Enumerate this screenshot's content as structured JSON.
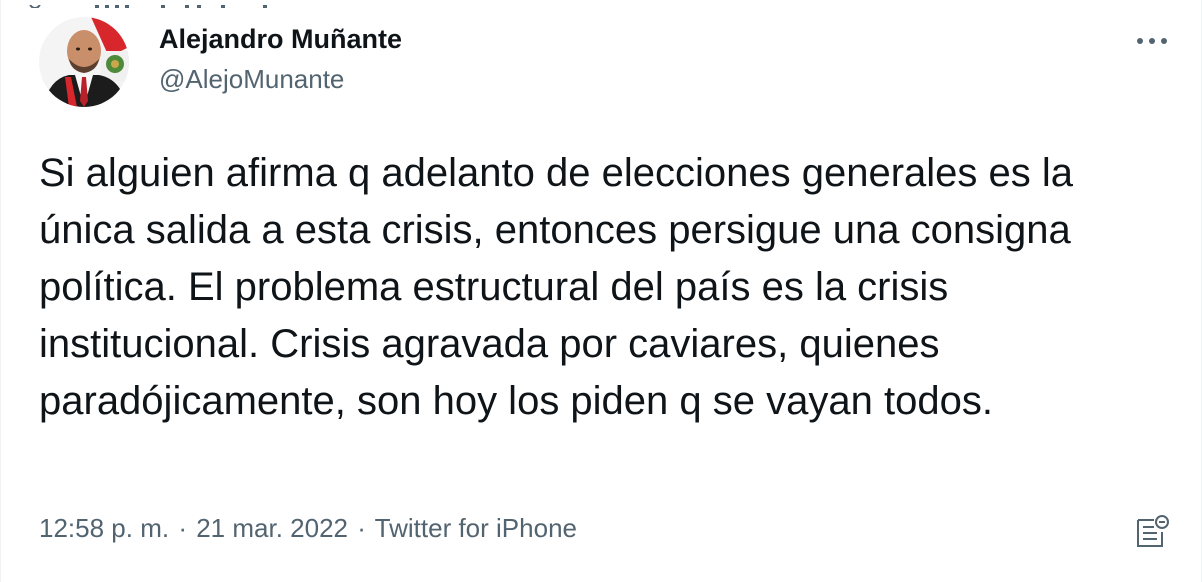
{
  "author": {
    "name": "Alejandro Muñante",
    "handle": "@AlejoMunante"
  },
  "tweet": {
    "text": "Si alguien afirma q adelanto de elecciones generales es la única salida a esta crisis, entonces persigue una consigna política. El problema estructural del país es la crisis institucional. Crisis agravada por caviares, quienes paradójicamente, son hoy los piden q se vayan todos.",
    "time": "12:58 p. m.",
    "separator": "·",
    "date": "21 mar. 2022",
    "source": "Twitter for iPhone"
  },
  "icons": {
    "more": "more-horizontal-icon",
    "activity": "tweet-analytics-icon"
  },
  "colors": {
    "text_primary": "#0f1419",
    "text_secondary": "#536471",
    "border": "#eff3f4"
  }
}
